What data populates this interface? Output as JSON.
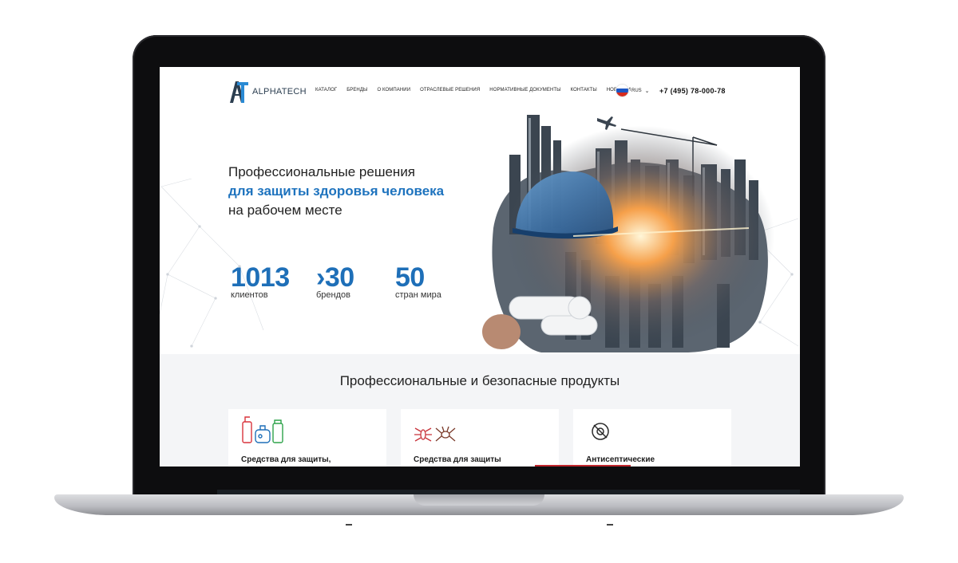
{
  "site": {
    "logo_text": "ALPHATECH",
    "nav": [
      "КАТАЛОГ",
      "БРЕНДЫ",
      "О КОМПАНИИ",
      "ОТРАСЛЕВЫЕ РЕШЕНИЯ",
      "НОРМАТИВНЫЕ ДОКУМЕНТЫ",
      "КОНТАКТЫ",
      "НОВОСТИ"
    ],
    "language": "RUS",
    "phone": "+7 (495) 78-000-78"
  },
  "hero": {
    "line1": "Профессиональные решения",
    "line2": "для защиты здоровья человека",
    "line3": "на рабочем месте",
    "stats": [
      {
        "value": "1013",
        "label": "клиентов"
      },
      {
        "value": "›30",
        "label": "брендов"
      },
      {
        "value": "50",
        "label": "стран мира"
      }
    ]
  },
  "products": {
    "title": "Профессиональные и безопасные продукты",
    "cards": [
      {
        "title": "Средства для защиты,",
        "icon": "bottles-icon"
      },
      {
        "title": "Средства для защиты",
        "icon": "insects-icon"
      },
      {
        "title": "Антисептические",
        "icon": "no-germs-icon"
      }
    ]
  },
  "colors": {
    "accent": "#1e6fb8",
    "highlight": "#1e73be",
    "laptop": "#0d0d0f"
  }
}
